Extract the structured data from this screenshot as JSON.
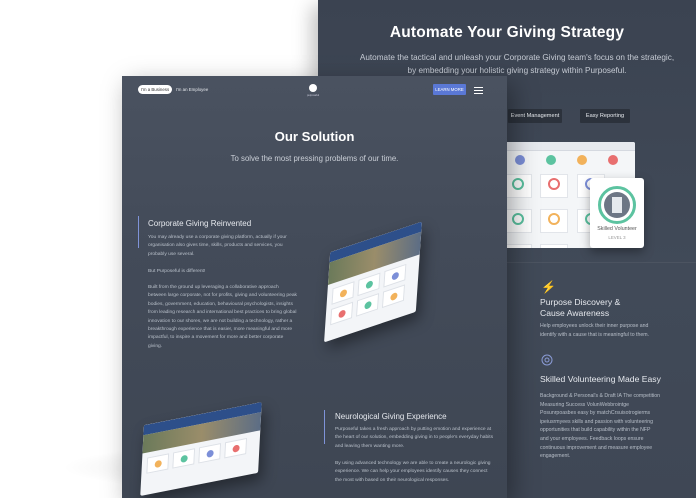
{
  "back_page": {
    "title": "Automate Your Giving Strategy",
    "subtitle": "Automate the tactical and unleash your Corporate Giving team's focus on the strategic, by embedding your holistic giving strategy within Purposeful.",
    "pills": [
      "Event Management",
      "Easy Reporting"
    ],
    "badge": {
      "label": "Skilled Volunteer",
      "level": "LEVEL 3"
    },
    "features": [
      {
        "icon": "lightning-icon",
        "title_line1": "Purpose Discovery &",
        "title_line2": "Cause Awareness",
        "body": "Help employees unlock their inner purpose and identify with a cause that is meaningful to them."
      },
      {
        "icon": "target-icon",
        "title": "Skilled Volunteering Made Easy",
        "body": "Background & Personal's & Draft IA The competition Measuring Success VolunWebbrointge Posunrpoasbes easy by matchCrsuisotrogierms ipeiusrmyees skills and passion with volunteering opportunities that build capability within the NFP and your employees. Feedback loops ensure continuous improvement and measure employee engagement."
      }
    ]
  },
  "front_page": {
    "nav": {
      "business_tab": "I'm a Business",
      "employee_tab": "I'm an Employee",
      "logo_text": "purposeful",
      "cta": "LEARN MORE"
    },
    "title": "Our Solution",
    "subtitle": "To solve the most pressing problems of our time.",
    "section1": {
      "title": "Corporate Giving Reinvented",
      "p1": "You may already use a corporate giving platform, actually if your organisation also gives time, skills, products and services, you probably use several.",
      "p2": "But Purposeful is different!",
      "p3": "Built from the ground up leveraging a collaborative approach between large corporate, not for profits, giving and volunteering peak bodies, government, education, behavioural psychologists, insights from leading research and international best practices to bring global innovation to our shores, we are not building a technology, rather a breakthrough experience that is easier, more meaningful and more impactful, to inspire a movement for more and better corporate giving."
    },
    "section2": {
      "title": "Neurological Giving Experience",
      "p1": "Purposeful takes a fresh approach by putting emotion and experience at the heart of our solution, embedding giving in to people's everyday habits and leaving them wanting more.",
      "p2": "By using advanced technology we are able to create a neurologic giving experience. We can help your employees identify causes they connect the most with based on their neurological responses."
    }
  },
  "colors": {
    "accent": "#5a78d6",
    "section_line": "#7f93d8",
    "badge_ring": "#5cc3a0",
    "page_dark": "#3b4351"
  }
}
